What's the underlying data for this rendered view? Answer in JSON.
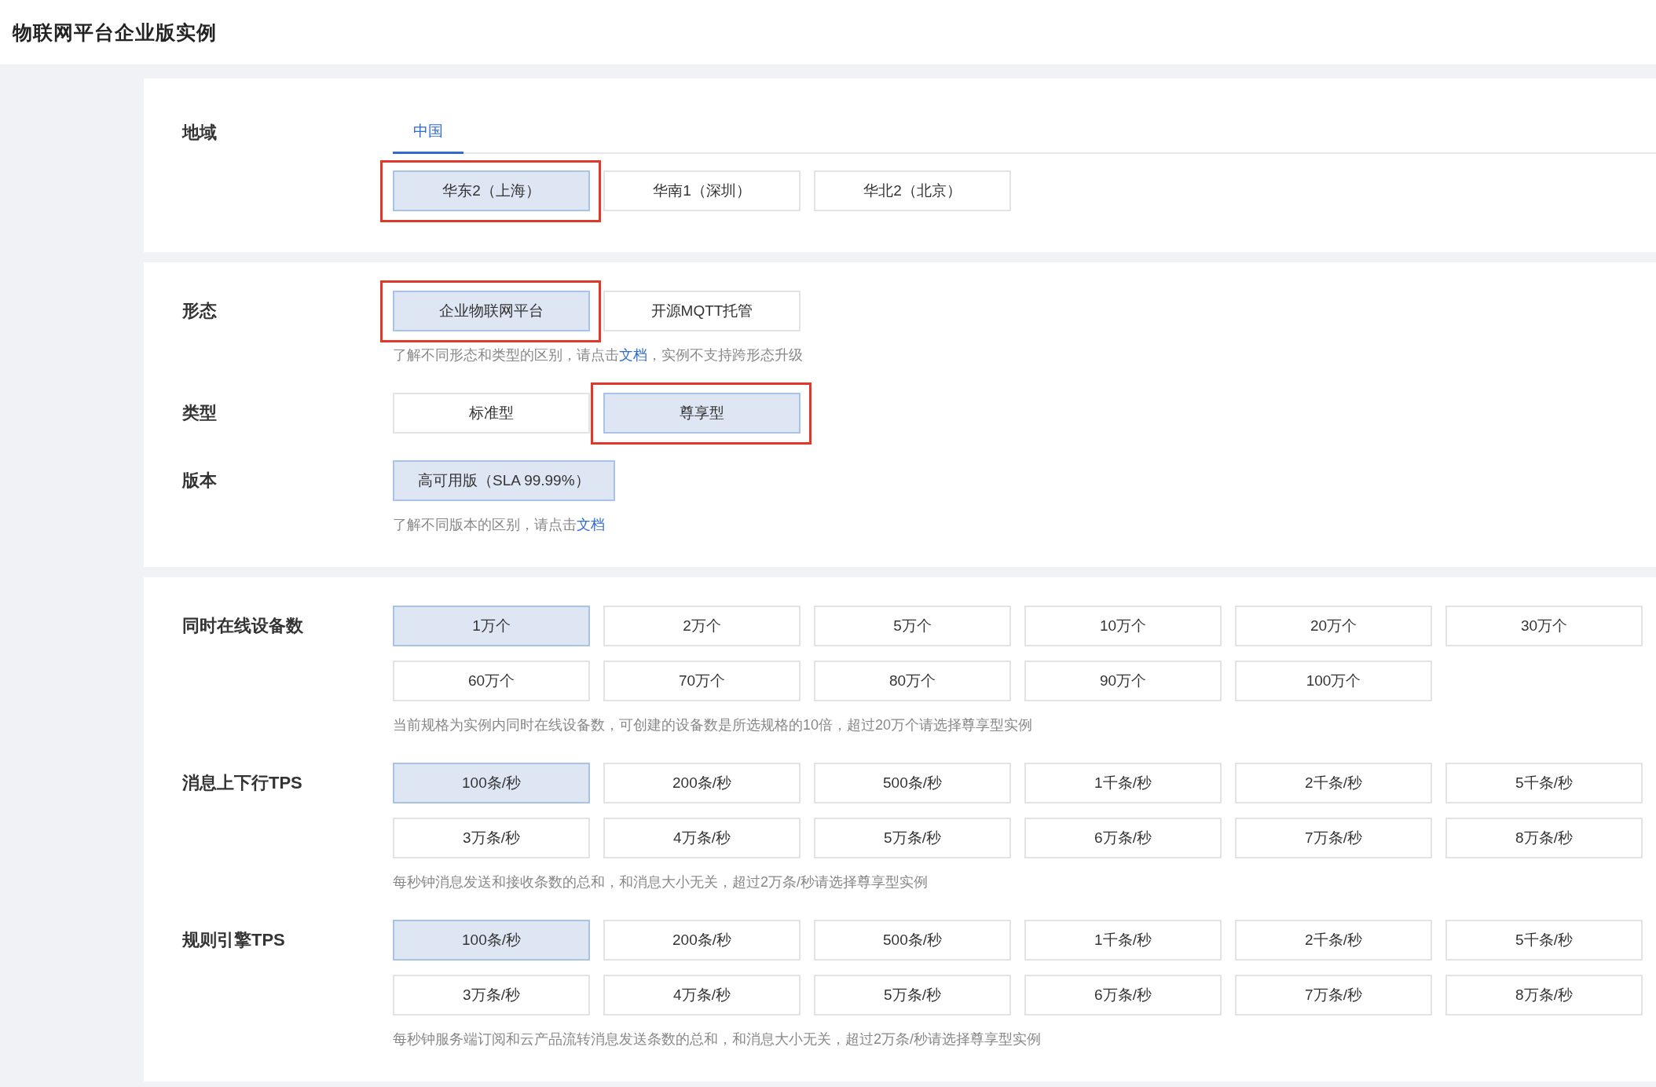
{
  "title": "物联网平台企业版实例",
  "sections": [
    {
      "rows": [
        {
          "label": "地域",
          "tabs": [
            {
              "label": "中国",
              "selected": true
            }
          ],
          "options": [
            {
              "label": "华东2（上海）",
              "selected": true,
              "highlighted": true
            },
            {
              "label": "华南1（深圳）",
              "selected": false,
              "highlighted": false
            },
            {
              "label": "华北2（北京）",
              "selected": false,
              "highlighted": false
            }
          ]
        }
      ]
    },
    {
      "rows": [
        {
          "label": "形态",
          "options": [
            {
              "label": "企业物联网平台",
              "selected": true,
              "highlighted": true
            },
            {
              "label": "开源MQTT托管",
              "selected": false,
              "highlighted": false
            }
          ],
          "hint": [
            {
              "text": "了解不同形态和类型的区别，请点击"
            },
            {
              "text": "文档",
              "kind": "link"
            },
            {
              "text": "，实例不支持跨形态升级"
            }
          ]
        },
        {
          "label": "类型",
          "options": [
            {
              "label": "标准型",
              "selected": false,
              "highlighted": false
            },
            {
              "label": "尊享型",
              "selected": true,
              "highlighted": true
            }
          ]
        },
        {
          "label": "版本",
          "options": [
            {
              "label": "高可用版（SLA 99.99%）",
              "selected": true,
              "highlighted": false
            }
          ],
          "hint": [
            {
              "text": "了解不同版本的区别，请点击"
            },
            {
              "text": "文档",
              "kind": "link"
            }
          ]
        }
      ]
    },
    {
      "rows": [
        {
          "label": "同时在线设备数",
          "options": [
            {
              "label": "1万个",
              "selected": true,
              "highlighted": false
            },
            {
              "label": "2万个",
              "selected": false,
              "highlighted": false
            },
            {
              "label": "5万个",
              "selected": false,
              "highlighted": false
            },
            {
              "label": "10万个",
              "selected": false,
              "highlighted": false
            },
            {
              "label": "20万个",
              "selected": false,
              "highlighted": false
            },
            {
              "label": "30万个",
              "selected": false,
              "highlighted": false
            },
            {
              "label": "60万个",
              "selected": false,
              "highlighted": false
            },
            {
              "label": "70万个",
              "selected": false,
              "highlighted": false
            },
            {
              "label": "80万个",
              "selected": false,
              "highlighted": false
            },
            {
              "label": "90万个",
              "selected": false,
              "highlighted": false
            },
            {
              "label": "100万个",
              "selected": false,
              "highlighted": false
            }
          ],
          "hint": [
            {
              "text": "当前规格为实例内同时在线设备数，可创建的设备数是所选规格的10倍，超过20万个请选择尊享型实例"
            }
          ]
        },
        {
          "label": "消息上下行TPS",
          "options": [
            {
              "label": "100条/秒",
              "selected": true,
              "highlighted": false
            },
            {
              "label": "200条/秒",
              "selected": false,
              "highlighted": false
            },
            {
              "label": "500条/秒",
              "selected": false,
              "highlighted": false
            },
            {
              "label": "1千条/秒",
              "selected": false,
              "highlighted": false
            },
            {
              "label": "2千条/秒",
              "selected": false,
              "highlighted": false
            },
            {
              "label": "5千条/秒",
              "selected": false,
              "highlighted": false
            },
            {
              "label": "3万条/秒",
              "selected": false,
              "highlighted": false
            },
            {
              "label": "4万条/秒",
              "selected": false,
              "highlighted": false
            },
            {
              "label": "5万条/秒",
              "selected": false,
              "highlighted": false
            },
            {
              "label": "6万条/秒",
              "selected": false,
              "highlighted": false
            },
            {
              "label": "7万条/秒",
              "selected": false,
              "highlighted": false
            },
            {
              "label": "8万条/秒",
              "selected": false,
              "highlighted": false
            }
          ],
          "hint": [
            {
              "text": "每秒钟消息发送和接收条数的总和，和消息大小无关，超过2万条/秒请选择尊享型实例"
            }
          ]
        },
        {
          "label": "规则引擎TPS",
          "options": [
            {
              "label": "100条/秒",
              "selected": true,
              "highlighted": false
            },
            {
              "label": "200条/秒",
              "selected": false,
              "highlighted": false
            },
            {
              "label": "500条/秒",
              "selected": false,
              "highlighted": false
            },
            {
              "label": "1千条/秒",
              "selected": false,
              "highlighted": false
            },
            {
              "label": "2千条/秒",
              "selected": false,
              "highlighted": false
            },
            {
              "label": "5千条/秒",
              "selected": false,
              "highlighted": false
            },
            {
              "label": "3万条/秒",
              "selected": false,
              "highlighted": false
            },
            {
              "label": "4万条/秒",
              "selected": false,
              "highlighted": false
            },
            {
              "label": "5万条/秒",
              "selected": false,
              "highlighted": false
            },
            {
              "label": "6万条/秒",
              "selected": false,
              "highlighted": false
            },
            {
              "label": "7万条/秒",
              "selected": false,
              "highlighted": false
            },
            {
              "label": "8万条/秒",
              "selected": false,
              "highlighted": false
            }
          ],
          "hint": [
            {
              "text": "每秒钟服务端订阅和云产品流转消息发送条数的总和，和消息大小无关，超过2万条/秒请选择尊享型实例"
            }
          ]
        }
      ]
    }
  ]
}
